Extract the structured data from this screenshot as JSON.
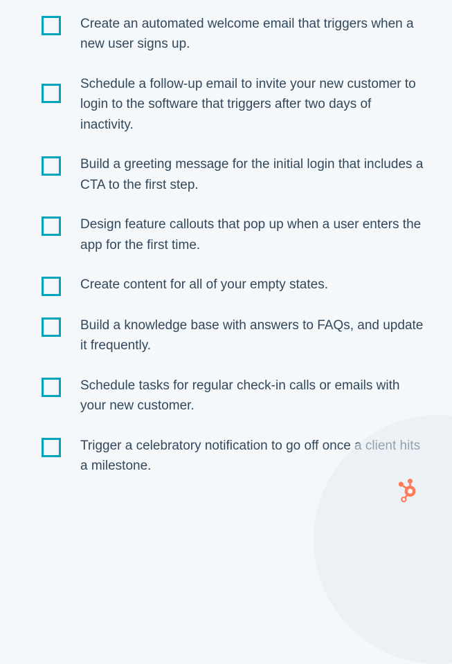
{
  "checklist": {
    "items": [
      {
        "text": "Create an automated welcome email that triggers when a new user signs up."
      },
      {
        "text": "Schedule a follow-up email to invite your new customer to login to the software that triggers after two days of inactivity."
      },
      {
        "text": "Build a greeting message for the initial login that includes a CTA to the first step."
      },
      {
        "text": "Design feature callouts that pop up when a user enters the app for the first time."
      },
      {
        "text": "Create content for all of your empty states."
      },
      {
        "text": "Build a knowledge base with answers to FAQs, and update it frequently."
      },
      {
        "text": "Schedule tasks for regular check-in calls or emails with your new customer."
      },
      {
        "text": "Trigger a celebratory notification to go off once a client hits a milestone."
      }
    ]
  },
  "logo_name": "hubspot-sprocket"
}
